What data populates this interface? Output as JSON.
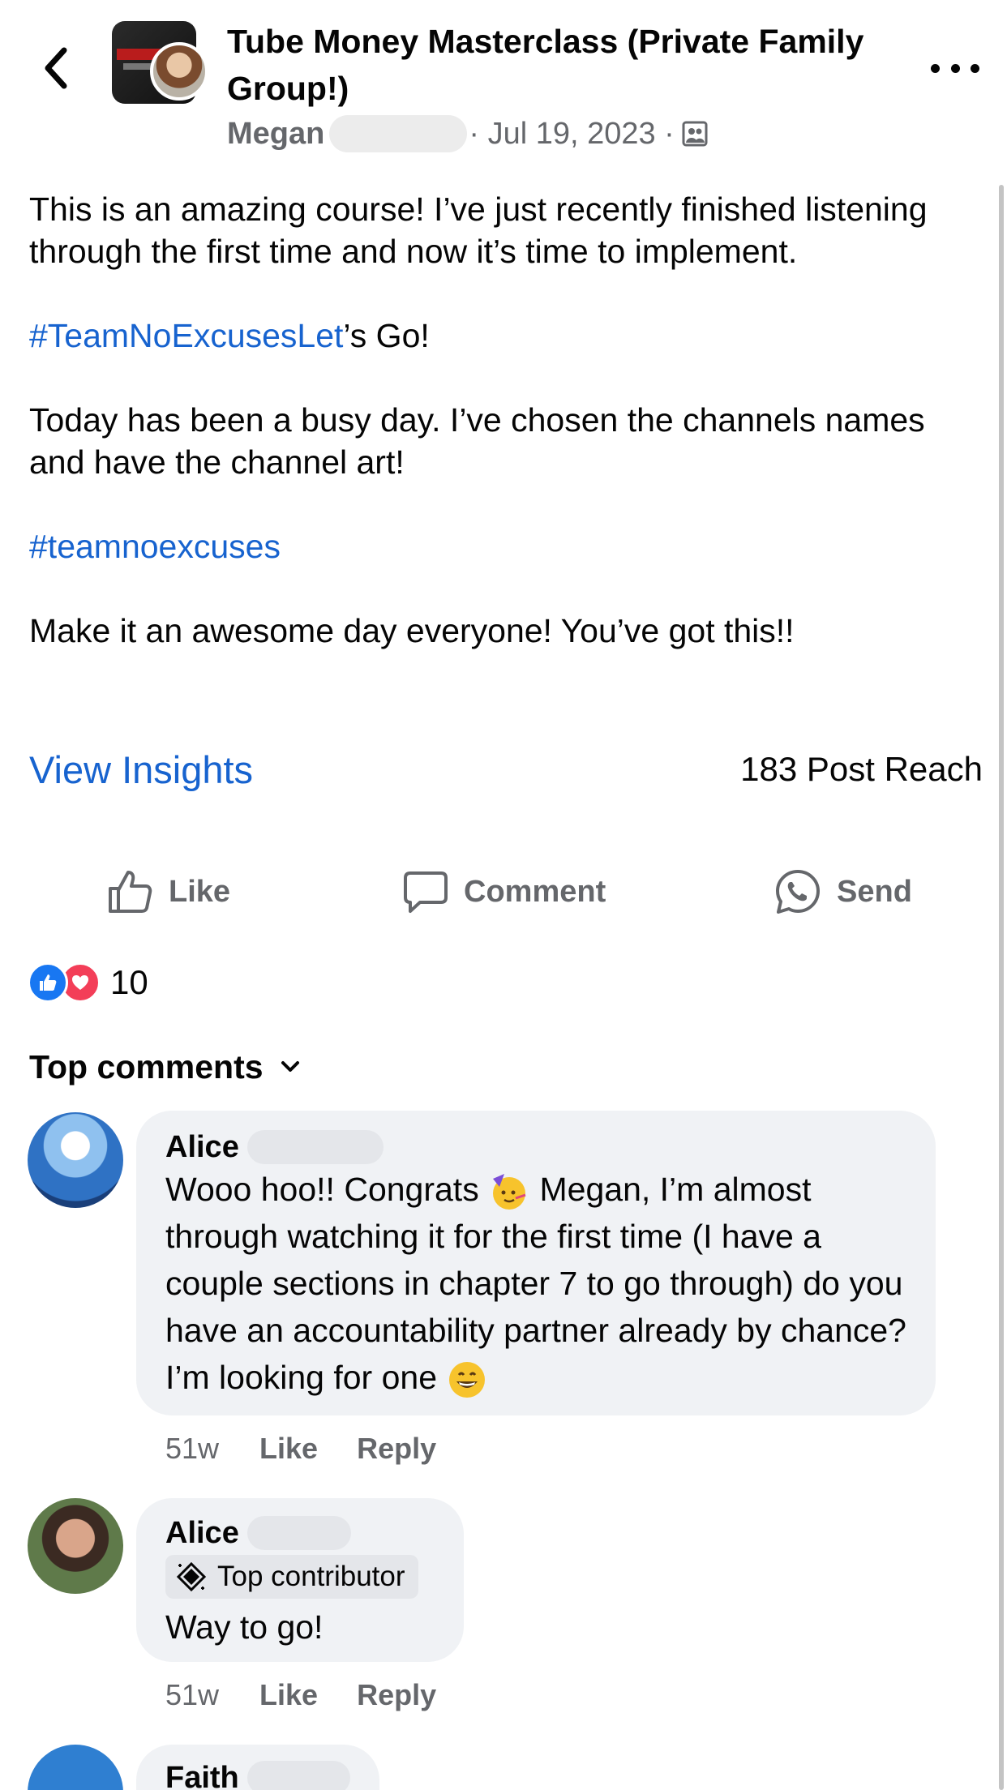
{
  "header": {
    "title": "Tube Money Masterclass (Private Family Group!)",
    "author": "Megan",
    "date": "· Jul 19, 2023 ·",
    "back_icon": "chevron-left-icon",
    "group_icon": "group-audience-icon",
    "more_icon": "more-horizontal-icon"
  },
  "post": {
    "p1": "This is an amazing course!  I’ve just recently finished listening through the first time and now it’s time to implement.",
    "hashtag1": "#TeamNoExcusesLet",
    "p2_after": "’s Go!",
    "p3": "Today has been a busy day. I’ve chosen the channels names and have the channel art!",
    "hashtag2": "#teamnoexcuses",
    "p5": "Make it an awesome day everyone! You’ve got this!!"
  },
  "insights": {
    "link": "View Insights",
    "reach": "183 Post Reach"
  },
  "actions": {
    "like": "Like",
    "comment": "Comment",
    "send": "Send"
  },
  "reactions": {
    "count": "10",
    "types": [
      "like",
      "love"
    ]
  },
  "comments_header": "Top comments",
  "comments": [
    {
      "name": "Alice",
      "text_a": "Wooo hoo!! Congrats",
      "text_b": "Megan, I’m almost through watching it for the first time (I have a couple sections in chapter 7 to go through) do you have an accountability partner already by chance? I’m looking for one",
      "time": "51w",
      "like": "Like",
      "reply": "Reply"
    },
    {
      "name": "Alice",
      "badge": "Top contributor",
      "text": "Way to go!",
      "time": "51w",
      "like": "Like",
      "reply": "Reply"
    },
    {
      "name": "Faith"
    }
  ],
  "colors": {
    "link": "#1763cf",
    "secondary_text": "#65676b",
    "bubble": "#f0f2f5",
    "like_blue": "#1877f2",
    "love_red": "#f33e58"
  }
}
